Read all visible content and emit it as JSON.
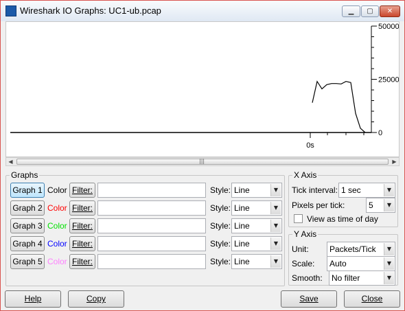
{
  "window": {
    "title": "Wireshark IO Graphs: UC1-ub.pcap"
  },
  "chart_data": {
    "type": "line",
    "x_labels": [
      "0s"
    ],
    "y_ticks": [
      "50000",
      "25000",
      "0"
    ],
    "ylim": [
      0,
      50000
    ],
    "series": [
      {
        "values": [
          14000,
          24000,
          20500,
          22500,
          23000,
          23000,
          22800,
          24000,
          23500,
          9000,
          2000,
          0
        ],
        "color": "#000000"
      }
    ]
  },
  "graphs": {
    "title": "Graphs",
    "color_label": "Color",
    "filter_label": "Filter:",
    "style_label": "Style:",
    "rows": [
      {
        "button": "Graph 1",
        "color": "#000000",
        "filter": "",
        "style": "Line"
      },
      {
        "button": "Graph 2",
        "color": "#ff0000",
        "filter": "",
        "style": "Line"
      },
      {
        "button": "Graph 3",
        "color": "#00e000",
        "filter": "",
        "style": "Line"
      },
      {
        "button": "Graph 4",
        "color": "#0000ff",
        "filter": "",
        "style": "Line"
      },
      {
        "button": "Graph 5",
        "color": "#ff7fff",
        "filter": "",
        "style": "Line"
      }
    ]
  },
  "x_axis": {
    "title": "X Axis",
    "tick_interval_label": "Tick interval:",
    "tick_interval_value": "1 sec",
    "pixels_per_tick_label": "Pixels per tick:",
    "pixels_per_tick_value": "5",
    "view_as_time_label": "View as time of day",
    "view_as_time_checked": false
  },
  "y_axis": {
    "title": "Y Axis",
    "unit_label": "Unit:",
    "unit_value": "Packets/Tick",
    "scale_label": "Scale:",
    "scale_value": "Auto",
    "smooth_label": "Smooth:",
    "smooth_value": "No filter"
  },
  "buttons": {
    "help": "Help",
    "copy": "Copy",
    "save": "Save",
    "close": "Close"
  }
}
